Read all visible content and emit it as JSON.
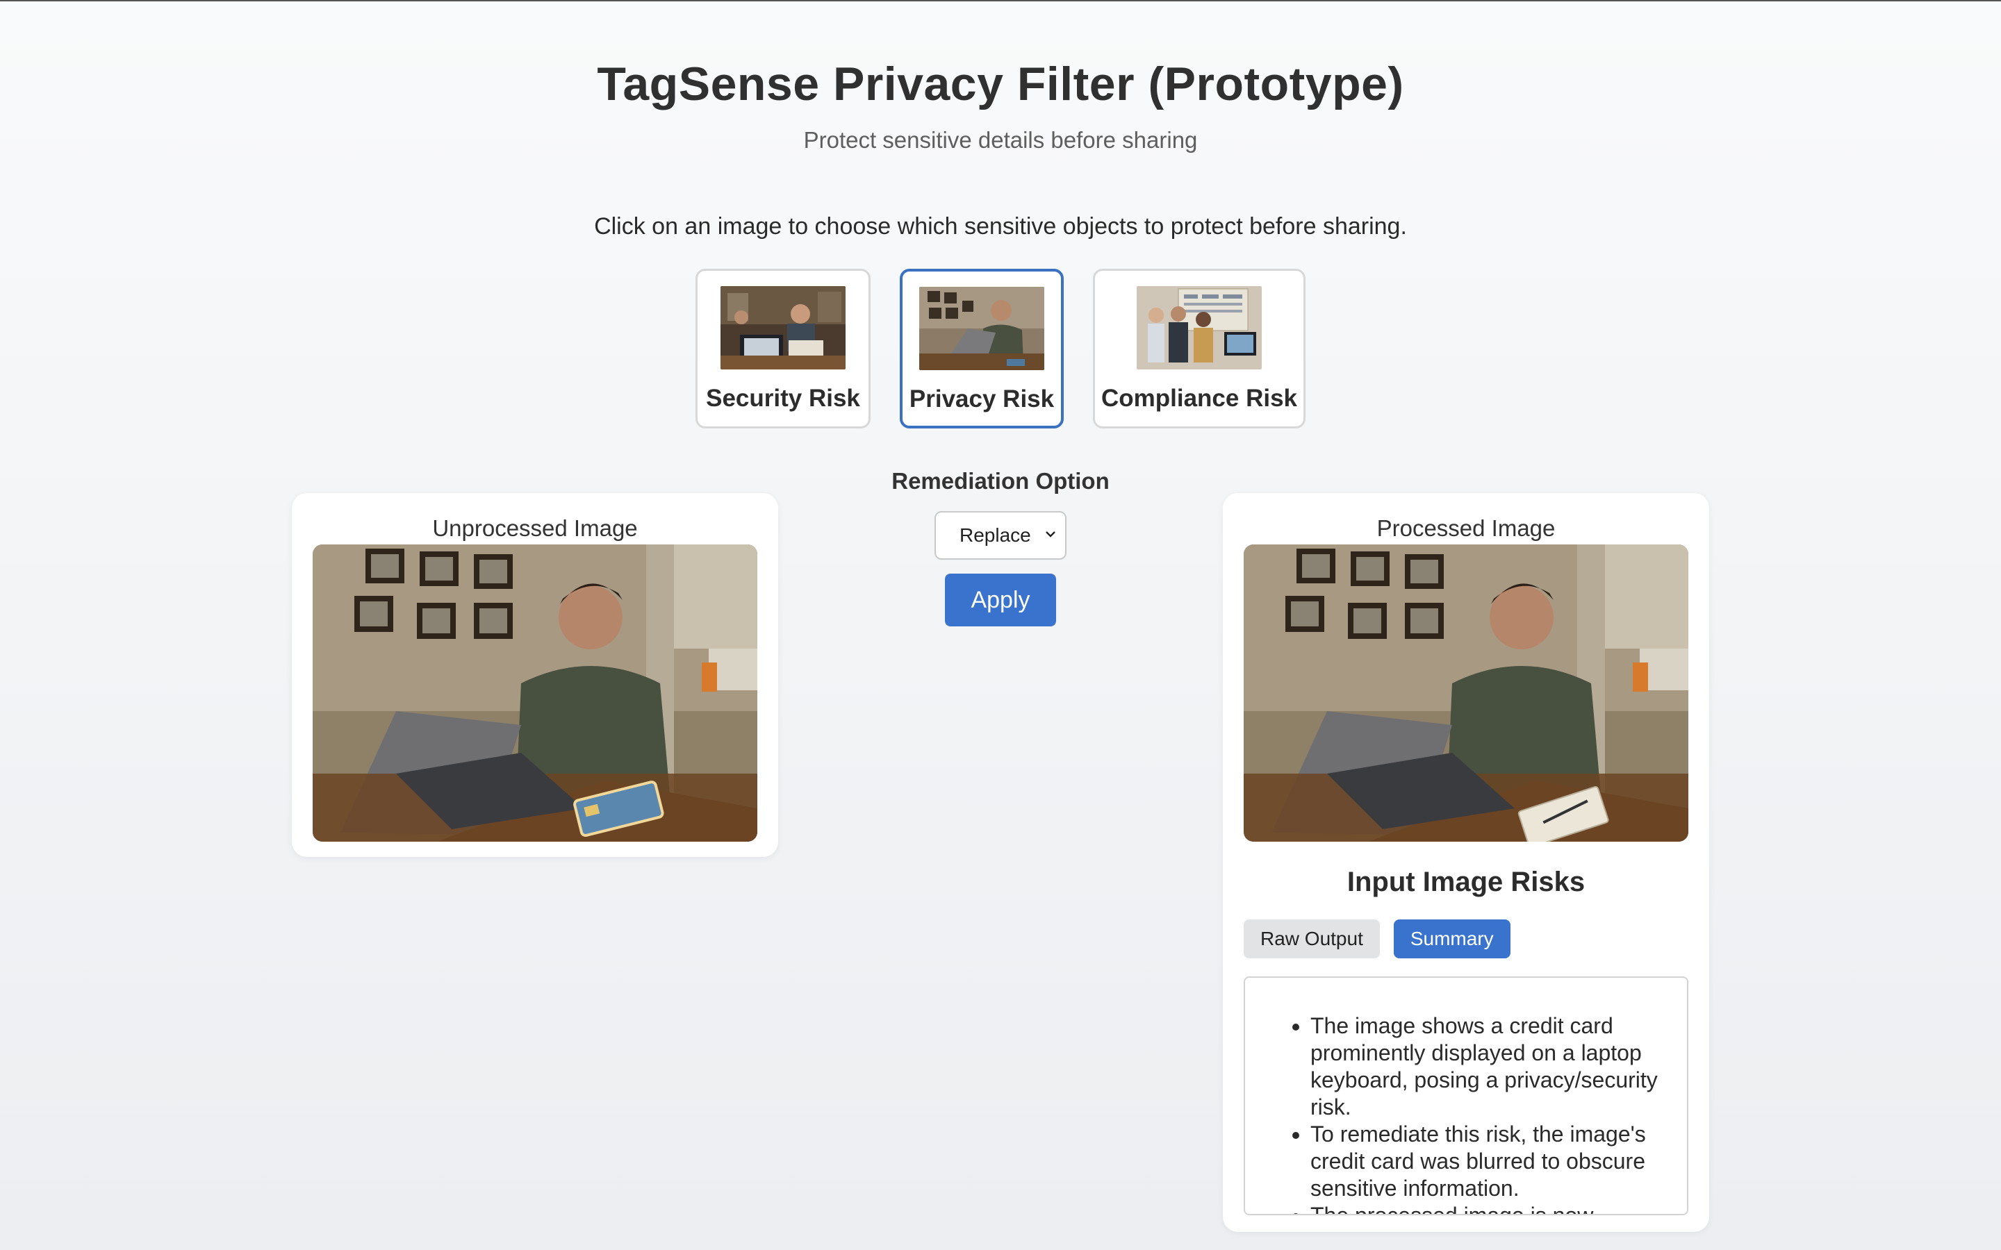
{
  "header": {
    "title": "TagSense Privacy Filter (Prototype)",
    "subtitle": "Protect sensitive details before sharing"
  },
  "instruction": "Click on an image to choose which sensitive objects to protect before sharing.",
  "scenarios": [
    {
      "label": "Security Risk",
      "selected": false
    },
    {
      "label": "Privacy Risk",
      "selected": true
    },
    {
      "label": "Compliance Risk",
      "selected": false
    }
  ],
  "unprocessed": {
    "title": "Unprocessed Image"
  },
  "remediation": {
    "label": "Remediation Option",
    "selected": "Replace",
    "apply_label": "Apply"
  },
  "processed": {
    "title": "Processed Image",
    "risks_title": "Input Image Risks",
    "tabs": [
      {
        "label": "Raw Output",
        "active": false
      },
      {
        "label": "Summary",
        "active": true
      }
    ],
    "summary": [
      "The image shows a credit card prominently displayed on a laptop keyboard, posing a privacy/security risk.",
      "To remediate this risk, the image's credit card was blurred to obscure sensitive information.",
      "The processed image is now"
    ]
  },
  "colors": {
    "accent": "#3a73cd",
    "selected_border": "#3a71c1"
  },
  "icons": {
    "select_caret": "chevron-down-icon"
  }
}
